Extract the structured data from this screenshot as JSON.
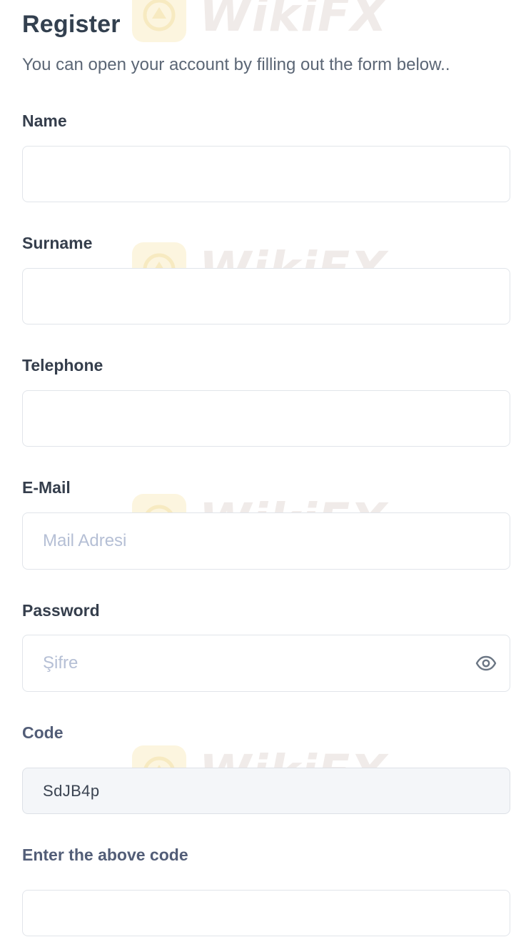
{
  "form": {
    "title": "Register",
    "subtitle": "You can open your account by filling out the form below..",
    "name_label": "Name",
    "name_value": "",
    "surname_label": "Surname",
    "surname_value": "",
    "telephone_label": "Telephone",
    "telephone_value": "",
    "email_label": "E-Mail",
    "email_placeholder": "Mail Adresi",
    "password_label": "Password",
    "password_placeholder": "Şifre",
    "code_label": "Code",
    "code_value": "SdJB4p",
    "enter_code_label": "Enter the above code",
    "enter_code_value": ""
  },
  "icons": {
    "password_toggle": "eye-icon"
  },
  "watermark": {
    "text": "WikiFX"
  },
  "colors": {
    "heading": "#33404f",
    "label": "#353e4c",
    "placeholder": "#b5bfd5",
    "border": "#e1e5ea",
    "code_background": "#f4f6f9"
  }
}
